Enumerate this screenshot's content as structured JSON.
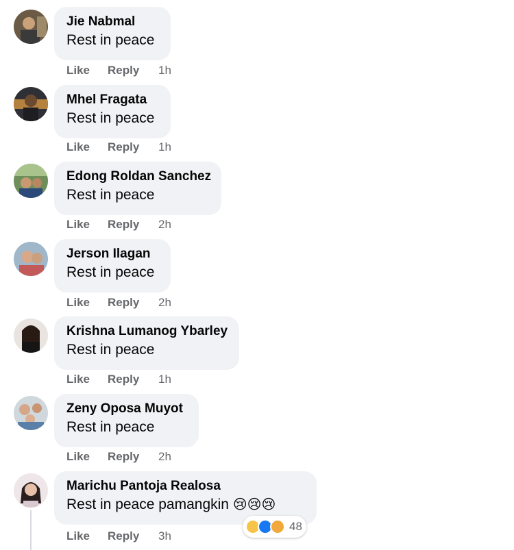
{
  "comments": [
    {
      "author": "Jie Nabmal",
      "text": "Rest in peace",
      "like": "Like",
      "reply": "Reply",
      "time": "1h"
    },
    {
      "author": "Mhel Fragata",
      "text": "Rest in peace",
      "like": "Like",
      "reply": "Reply",
      "time": "1h"
    },
    {
      "author": "Edong Roldan Sanchez",
      "text": "Rest in peace",
      "like": "Like",
      "reply": "Reply",
      "time": "2h"
    },
    {
      "author": "Jerson Ilagan",
      "text": "Rest in peace",
      "like": "Like",
      "reply": "Reply",
      "time": "2h"
    },
    {
      "author": "Krishna Lumanog Ybarley",
      "text": "Rest in peace",
      "like": "Like",
      "reply": "Reply",
      "time": "1h"
    },
    {
      "author": "Zeny Oposa Muyot",
      "text": "Rest in peace",
      "like": "Like",
      "reply": "Reply",
      "time": "2h"
    },
    {
      "author": "Marichu Pantoja Realosa",
      "text": "Rest in peace pamangkin",
      "emoji": "😢😢😢",
      "like": "Like",
      "reply": "Reply",
      "time": "3h"
    }
  ],
  "reactions": {
    "icons": [
      "sad-icon",
      "like-icon",
      "care-icon"
    ],
    "count": "48"
  }
}
